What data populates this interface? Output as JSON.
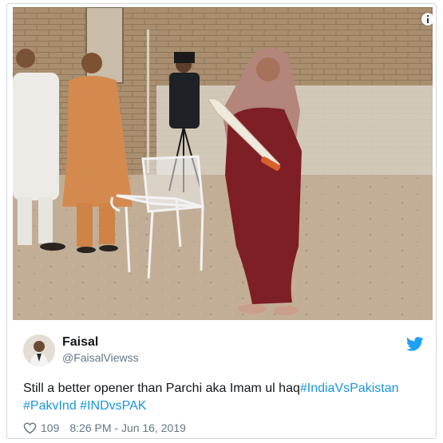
{
  "tweet": {
    "author_name": "Faisal",
    "author_handle": "@FaisalViewss",
    "text_plain": "Still a better opener than Parchi aka Imam ul haq",
    "hashtags": [
      "#IndiaVsPakistan",
      "#PakvInd",
      "#INDvsPAK"
    ],
    "likes": "109",
    "timestamp": "8:26 PM - Jun 16, 2019"
  },
  "icons": {
    "info": "info-icon",
    "brand": "bird-icon",
    "like": "heart-icon",
    "avatar": "avatar"
  },
  "colors": {
    "link": "#1b95e0",
    "secondary_text": "#657786",
    "primary_text": "#14171a",
    "border": "#d4d9dd"
  }
}
